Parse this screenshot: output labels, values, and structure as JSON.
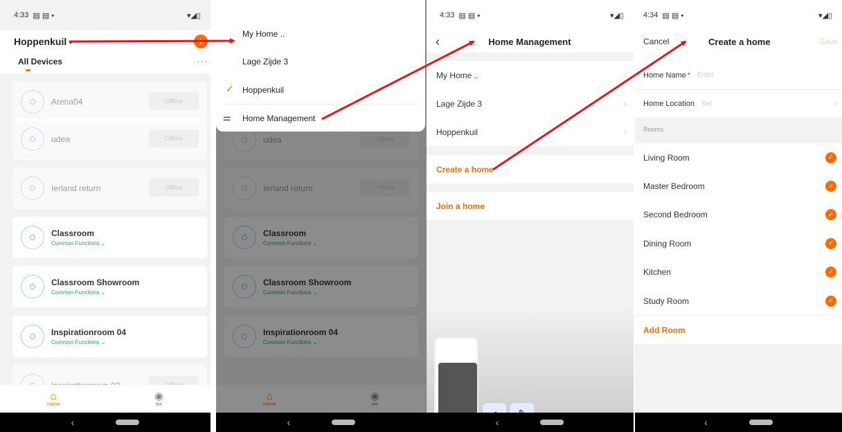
{
  "panel1": {
    "status_time": "4:33",
    "home_name": "Hoppenkuil",
    "tab_all_devices": "All Devices",
    "devices": [
      {
        "name": "Arena04",
        "status": "Offline",
        "offline": true
      },
      {
        "name": "udea",
        "status": "Offline",
        "offline": true
      },
      {
        "name": "Ierland return",
        "status": "Offline",
        "offline": true
      },
      {
        "name": "Classroom",
        "sub": "Common Functions ⌄",
        "offline": false
      },
      {
        "name": "Classroom Showroom",
        "sub": "Common Functions ⌄",
        "offline": false
      },
      {
        "name": "Inspirationroom 04",
        "sub": "Common Functions ⌄",
        "offline": false
      },
      {
        "name": "Inspirationroom 03",
        "status": "Offline",
        "offline": true
      }
    ],
    "tabbar": {
      "home": "Home",
      "me": "Me"
    }
  },
  "panel2": {
    "menu": [
      "My Home ..",
      "Lage Zijde 3",
      "Hoppenkuil",
      "Home Management"
    ],
    "selected": "Hoppenkuil",
    "dimmed_devices": [
      "udea",
      "Ierland return",
      "Classroom",
      "Classroom Showroom",
      "Inspirationroom 04"
    ],
    "dimmed_sub": "Common Functions ⌄",
    "dimmed_status": "Offline",
    "tabbar": {
      "home": "Home",
      "me": "Me"
    }
  },
  "panel3": {
    "status_time": "4:33",
    "title": "Home Management",
    "homes": [
      "My Home ..",
      "Lage Zijde 3",
      "Hoppenkuil"
    ],
    "create": "Create a home",
    "join": "Join a home"
  },
  "panel4": {
    "status_time": "4:34",
    "cancel": "Cancel",
    "title": "Create a home",
    "save": "Save",
    "home_name_label": "Home Name",
    "home_name_placeholder": "Enter",
    "home_location_label": "Home Location",
    "home_location_placeholder": "Set",
    "rooms_label": "Rooms:",
    "rooms": [
      "Living Room",
      "Master Bedroom",
      "Second Bedroom",
      "Dining Room",
      "Kitchen",
      "Study Room"
    ],
    "add_room": "Add Room"
  },
  "colors": {
    "accent": "#ff6a00",
    "green": "#1aa67e",
    "arrow": "#e8141a"
  }
}
